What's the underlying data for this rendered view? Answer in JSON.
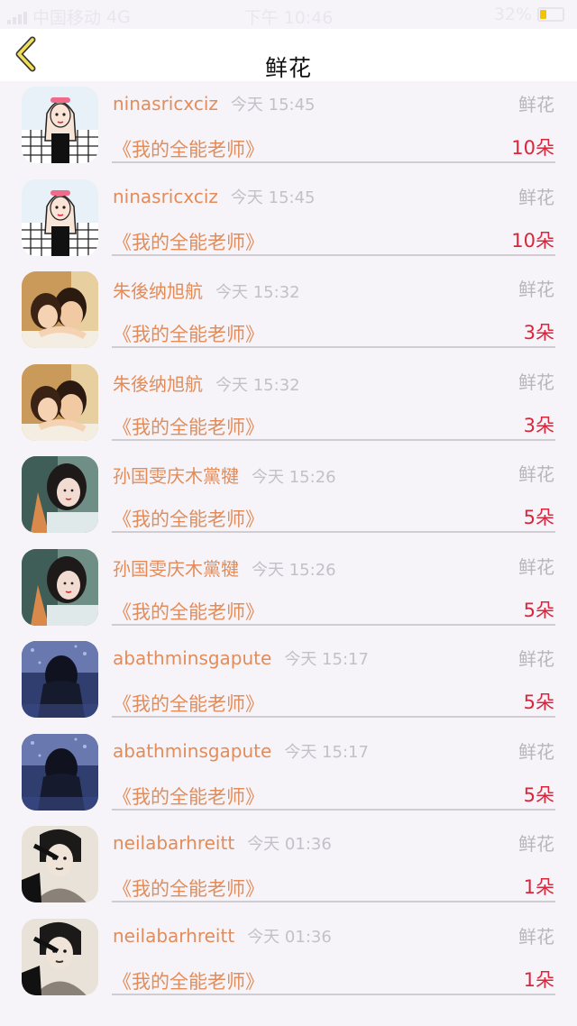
{
  "status_bar": {
    "carrier": "中国移动",
    "network": "4G",
    "time": "下午 10:46",
    "battery": "32%",
    "battery_level": 0.32,
    "battery_color": "#f5c400"
  },
  "nav": {
    "back_icon": "chevron-left-icon",
    "title": "鲜花"
  },
  "colors": {
    "name": "#e38c59",
    "count": "#d8263c",
    "muted": "#b8b6bb"
  },
  "items": [
    {
      "name": "ninasricxciz",
      "time": "今天 15:45",
      "type": "鲜花",
      "book": "《我的全能老师》",
      "count": "10朵",
      "avatar": "cartoon-girl"
    },
    {
      "name": "ninasricxciz",
      "time": "今天 15:45",
      "type": "鲜花",
      "book": "《我的全能老师》",
      "count": "10朵",
      "avatar": "cartoon-girl"
    },
    {
      "name": "朱後纳旭航",
      "time": "今天 15:32",
      "type": "鲜花",
      "book": "《我的全能老师》",
      "count": "3朵",
      "avatar": "couple-photo"
    },
    {
      "name": "朱後纳旭航",
      "time": "今天 15:32",
      "type": "鲜花",
      "book": "《我的全能老师》",
      "count": "3朵",
      "avatar": "couple-photo"
    },
    {
      "name": "孙国雯庆木黨犍",
      "time": "今天 15:26",
      "type": "鲜花",
      "book": "《我的全能老师》",
      "count": "5朵",
      "avatar": "girl-portrait"
    },
    {
      "name": "孙国雯庆木黨犍",
      "time": "今天 15:26",
      "type": "鲜花",
      "book": "《我的全能老师》",
      "count": "5朵",
      "avatar": "girl-portrait"
    },
    {
      "name": "abathminsgapute",
      "time": "今天 15:17",
      "type": "鲜花",
      "book": "《我的全能老师》",
      "count": "5朵",
      "avatar": "night-silhouette"
    },
    {
      "name": "abathminsgapute",
      "time": "今天 15:17",
      "type": "鲜花",
      "book": "《我的全能老师》",
      "count": "5朵",
      "avatar": "night-silhouette"
    },
    {
      "name": "neilabarhreitt",
      "time": "今天 01:36",
      "type": "鲜花",
      "book": "《我的全能老师》",
      "count": "1朵",
      "avatar": "vintage-lady"
    },
    {
      "name": "neilabarhreitt",
      "time": "今天 01:36",
      "type": "鲜花",
      "book": "《我的全能老师》",
      "count": "1朵",
      "avatar": "vintage-lady"
    }
  ]
}
